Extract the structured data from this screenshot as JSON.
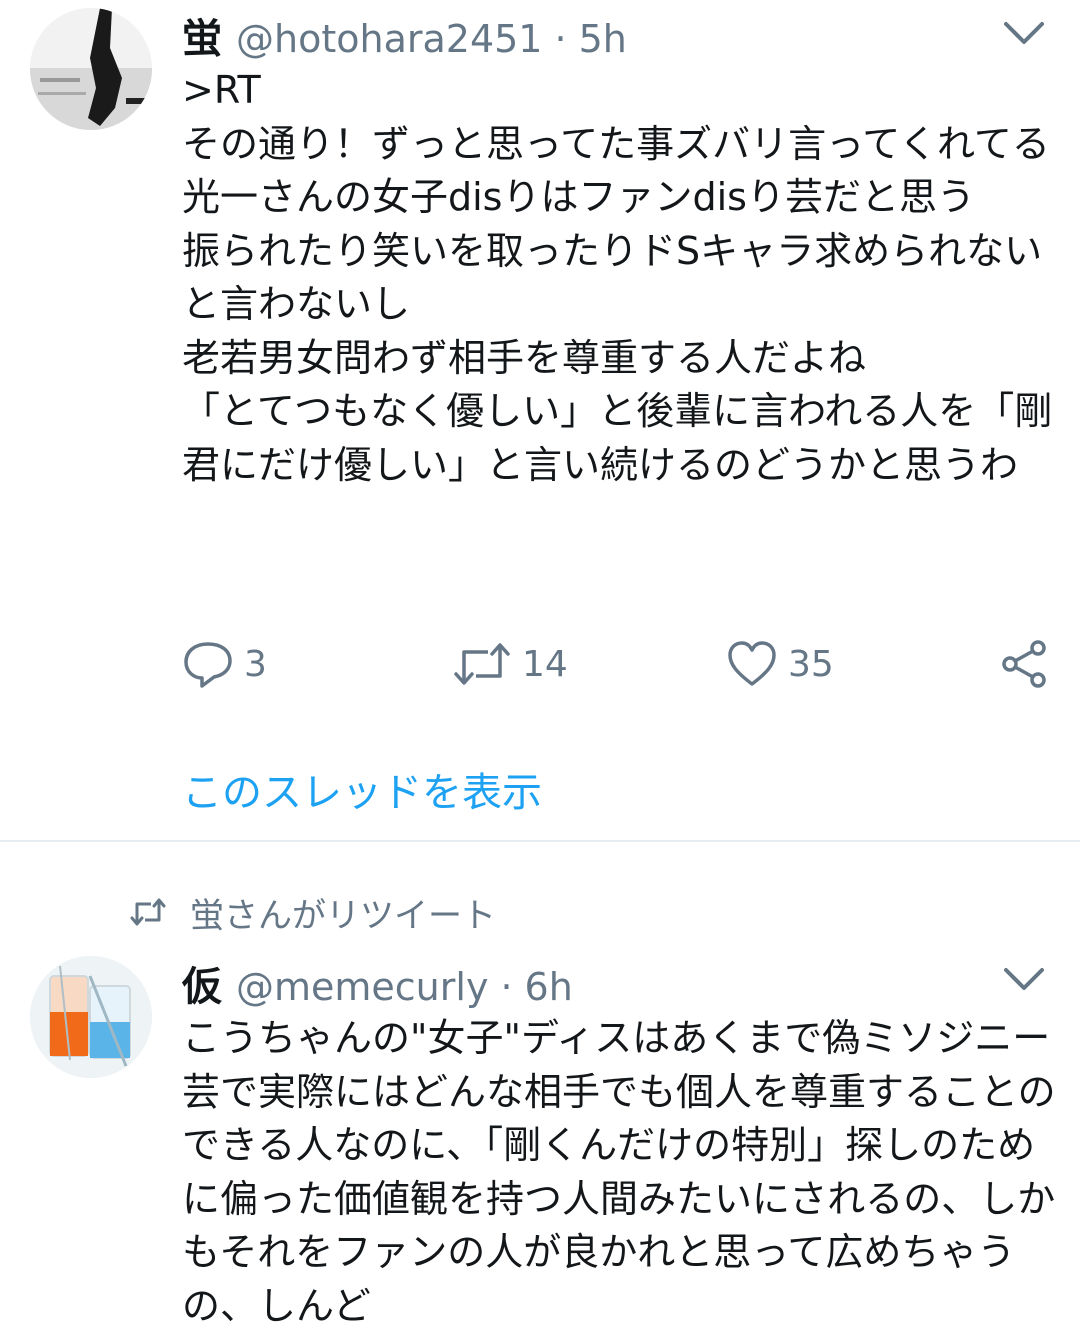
{
  "tweets": [
    {
      "name": "蛍",
      "handle": "@hotohara2451",
      "separator": "·",
      "time": "5h",
      "text": ">RT\nその通り！ずっと思ってた事ズバリ言ってくれてる\n光一さんの女子disりはファンdisり芸だと思う\n振られたり笑いを取ったりドSキャラ求められないと言わないし\n老若男女問わず相手を尊重する人だよね\n「とてつもなく優しい」と後輩に言われる人を「剛君にだけ優しい」と言い続けるのどうかと思うわ",
      "actions": {
        "reply_icon": "reply-icon",
        "reply_count": "3",
        "retweet_icon": "retweet-icon",
        "retweet_count": "14",
        "like_icon": "heart-icon",
        "like_count": "35",
        "share_icon": "share-icon"
      },
      "thread_link": "このスレッドを表示"
    },
    {
      "retweet_context": "蛍さんがリツイート",
      "name": "仮",
      "handle": "@memecurly",
      "separator": "·",
      "time": "6h",
      "text": "こうちゃんの\"女子\"ディスはあくまで偽ミソジニー芸で実際にはどんな相手でも個人を尊重することのできる人なのに、「剛くんだけの特別」探しのために偏った価値観を持つ人間みたいにされるの、しかもそれをファンの人が良かれと思って広めちゃうの、しんど"
    }
  ],
  "colors": {
    "accent": "#1da1f2",
    "secondary_text": "#657786",
    "divider": "#e6ecf0"
  }
}
